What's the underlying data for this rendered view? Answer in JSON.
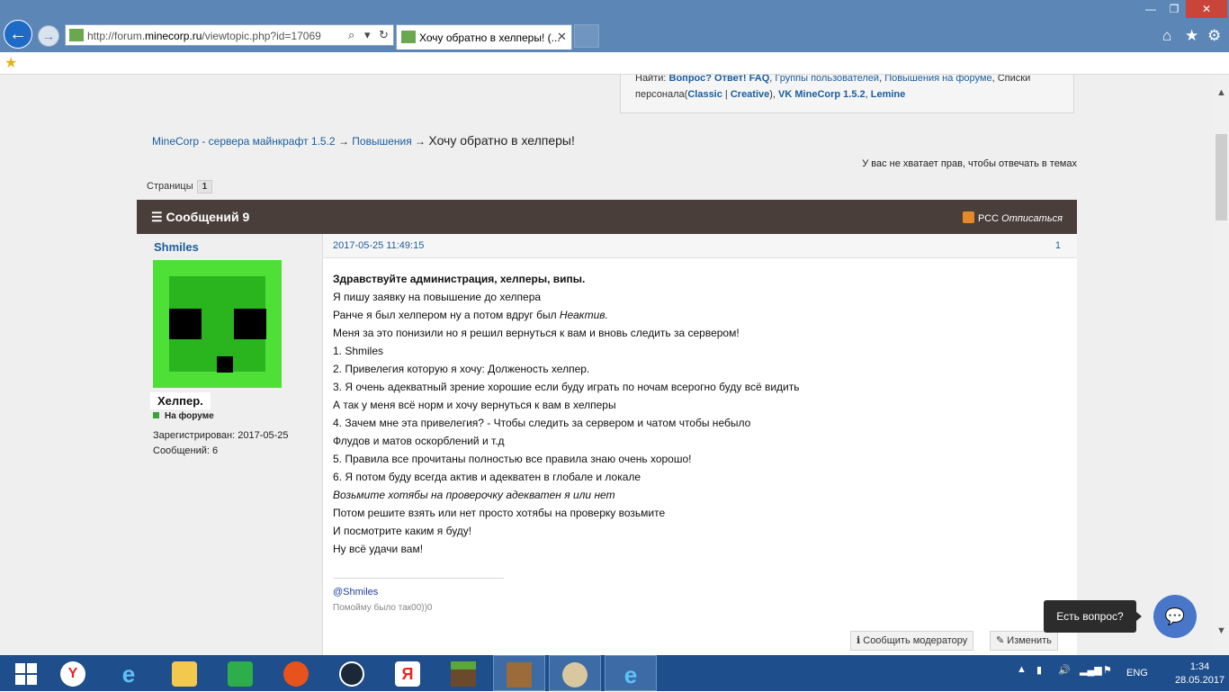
{
  "browser": {
    "url_prefix": "http://forum.",
    "url_domain": "minecorp.ru",
    "url_suffix": "/viewtopic.php?id=17069",
    "tab_title": "Хочу обратно в хелперы! (...",
    "tab_close": "✕",
    "search_icon": "⌕",
    "dropdown_icon": "▾",
    "refresh_icon": "↻",
    "back_icon": "←",
    "forward_icon": "→",
    "tools": {
      "home": "⌂",
      "favorites": "★",
      "settings": "⚙"
    },
    "window": {
      "minimize": "—",
      "restore": "❐",
      "close": "✕"
    }
  },
  "infobox": {
    "find_prefix": "Найти: ",
    "find_link": "Вопрос? Ответ! FAQ",
    "sep1": ", ",
    "groups_link": "Группы пользователей",
    "sep2": ", ",
    "promo_link": "Повышения на форуме",
    "lists_tail": ", Списки",
    "staff_prefix": "персонала(",
    "classic_link": "Classic",
    "pipe": " | ",
    "creative_link": "Creative",
    "paren_close": "), ",
    "vk_link": "VK MineCorp 1.5.2",
    "sep3": ", ",
    "lemine_link": "Lemine"
  },
  "breadcrumb": {
    "root": "MineCorp - сервера майнкрафт 1.5.2",
    "arrow": " → ",
    "section": "Повышения",
    "current": "Хочу обратно в хелперы!"
  },
  "no_permission": "У вас не хватает прав, чтобы отвечать в темах",
  "pages": {
    "label": "Страницы",
    "current": "1"
  },
  "topic": {
    "header_title": "Сообщений 9",
    "rss_label": "РСС",
    "unsubscribe": "Отписаться"
  },
  "author": {
    "name": "Shmiles",
    "rank": "Хелпер.",
    "status": "На форуме",
    "registered": "Зарегистрирован: 2017-05-25",
    "posts": "Сообщений: 6"
  },
  "post": {
    "date": "2017-05-25 11:49:15",
    "number": "1",
    "line1": "Здравствуйте администрация, хелперы, випы.",
    "line2": "Я пишу заявку на повышение до хелпера",
    "line3_a": "Ранче я был хелпером ну а потом вдруг был ",
    "line3_b": "Неактив.",
    "line4": "Меня за это понизили но я решил вернуться к вам и вновь следить за сервером!",
    "line5": "1. Shmiles",
    "line6": "2. Привелегия которую я хочу: Долженость хелпер.",
    "line7": "3. Я очень адекватный зрение хорошие если буду играть по ночам всерогно буду всё видить",
    "line8": "А так у меня всё норм и хочу вернуться к вам в хелперы",
    "line9": "4. Зачем мне эта привелегия? - Чтобы следить за сервером и чатом чтобы небыло",
    "line10": "Флудов и матов оскорблений и т.д",
    "line11": "5. Правила все прочитаны полностью все правила знаю очень хорошо!",
    "line12": "6. Я потом буду всегда актив и адекватен в глобале и локале",
    "line13": "Возьмите хотябы на проверочку адекватен я или нет",
    "line14": "Потом решите взять или нет просто хотябы на проверку возьмите",
    "line15": "И посмотрите каким я буду!",
    "line16": "Ну всё удачи вам!",
    "sig1": "@Shmiles",
    "sig2": "Помойму было так00))0",
    "report_button": "Сообщить модератору",
    "edit_button": "Изменить"
  },
  "chat": {
    "tooltip": "Есть вопрос?"
  },
  "taskbar": {
    "lang": "ENG",
    "time": "1:34",
    "date": "28.05.2017"
  }
}
